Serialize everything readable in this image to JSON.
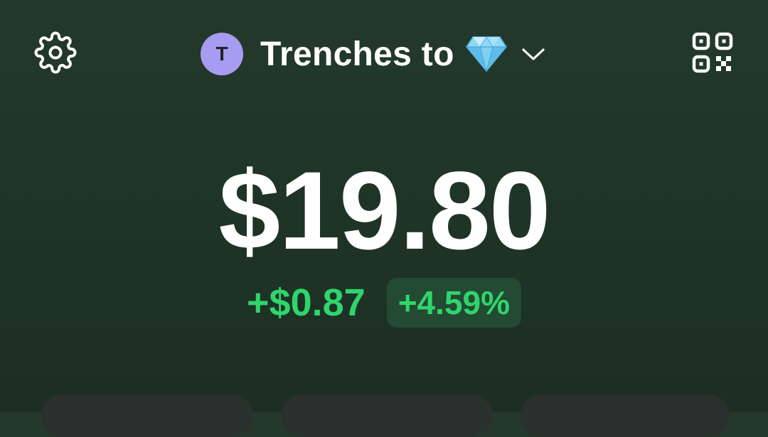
{
  "header": {
    "settings_icon": "gear-icon",
    "qr_icon": "qr-code-icon",
    "account": {
      "avatar_letter": "T",
      "avatar_color": "#a79bf2",
      "name": "Trenches to",
      "emoji_icon": "gem-icon",
      "chevron_icon": "chevron-down-icon"
    }
  },
  "portfolio": {
    "balance": "$19.80",
    "change_amount": "+$0.87",
    "change_percent": "+4.59%",
    "change_color": "#2fd56b"
  },
  "colors": {
    "background": "#22382a",
    "text": "#ffffff",
    "percent_badge_bg": "#234a33"
  }
}
